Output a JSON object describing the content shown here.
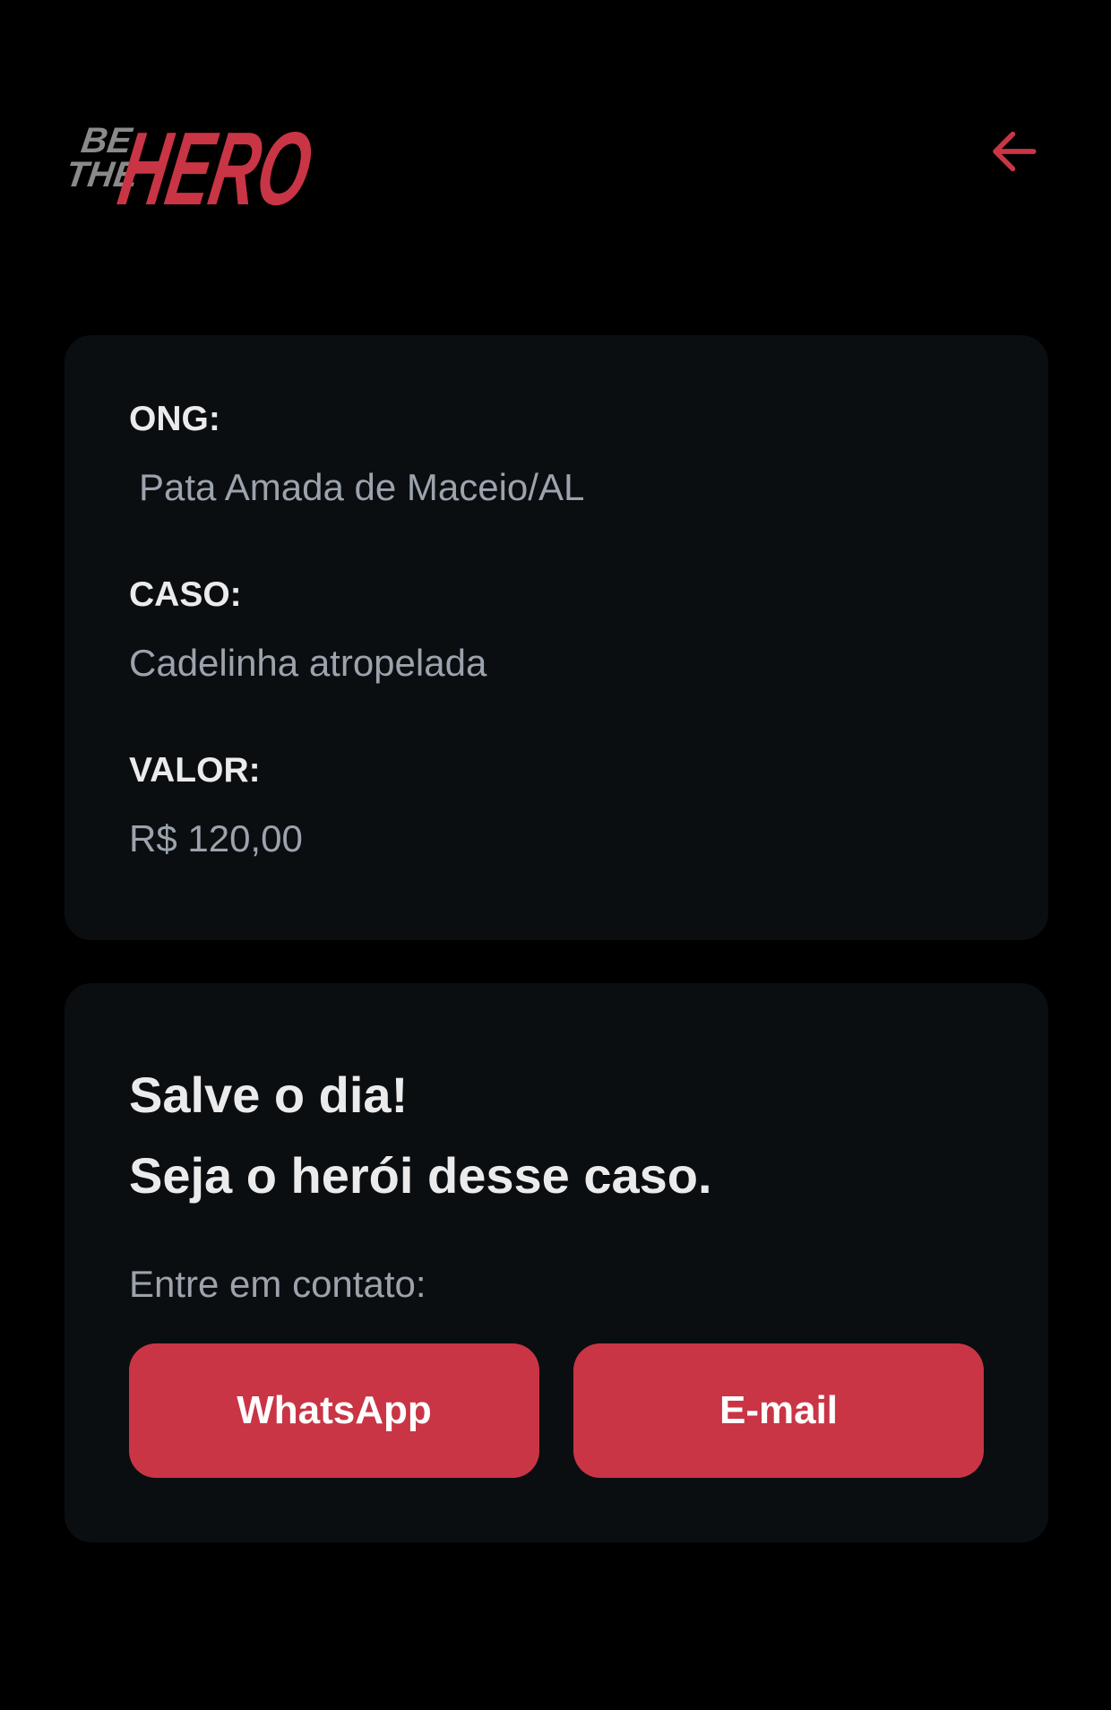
{
  "brand": {
    "logo_line1": "BE",
    "logo_line2": "THE",
    "logo_main": "HERO",
    "accent_color": "#c93545"
  },
  "header": {
    "back_icon": "arrow-left-icon"
  },
  "incident": {
    "ong_label": "ONG:",
    "ong_value": "Pata Amada de Maceio/AL",
    "case_label": "CASO:",
    "case_value": "Cadelinha atropelada",
    "value_label": "VALOR:",
    "value_value": "R$ 120,00"
  },
  "contact": {
    "title_line1": "Salve o dia!",
    "title_line2": "Seja o herói desse caso.",
    "subtitle": "Entre em contato:",
    "whatsapp_label": "WhatsApp",
    "email_label": "E-mail"
  }
}
